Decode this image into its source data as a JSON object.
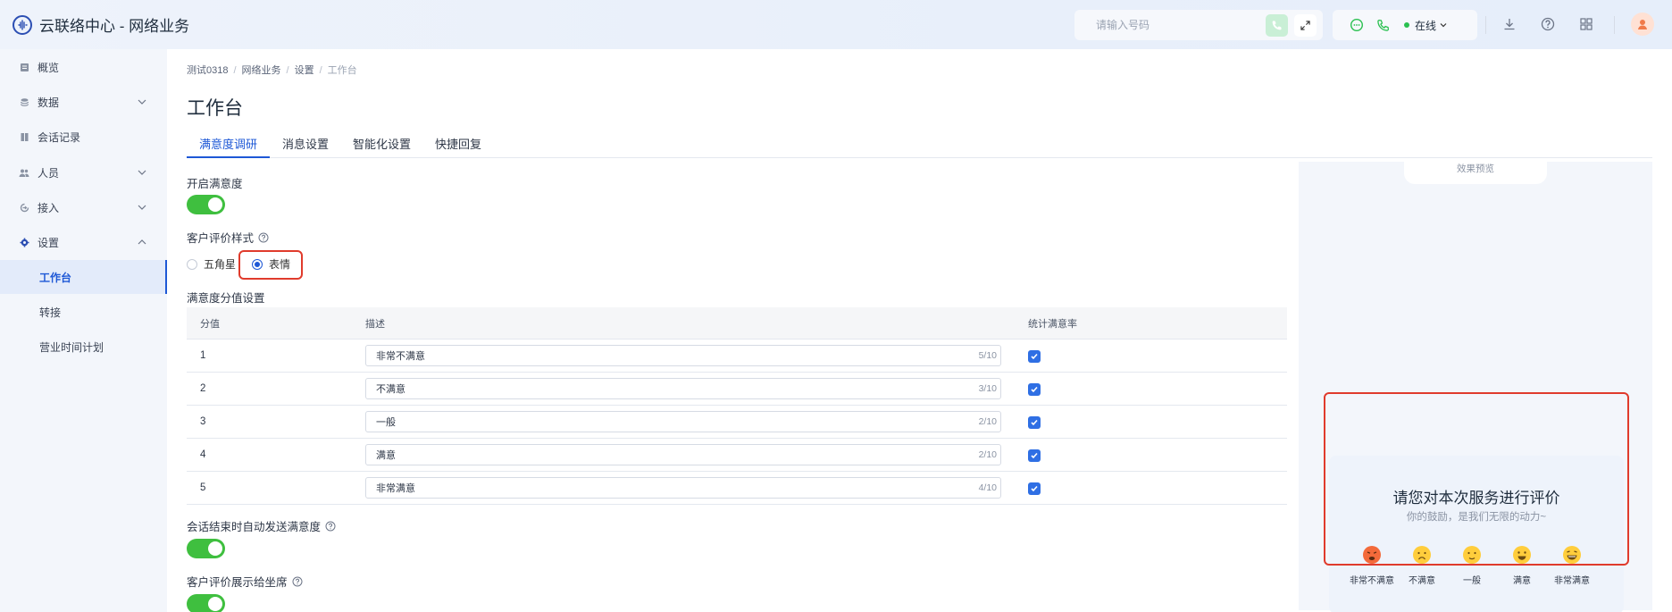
{
  "app": {
    "title": "云联络中心 - 网络业务"
  },
  "topbar": {
    "phone_placeholder": "请输入号码",
    "status_label": "在线",
    "icons": [
      "message-icon",
      "phone-icon",
      "download-icon",
      "help-icon",
      "grid-icon",
      "avatar"
    ]
  },
  "sidebar": {
    "items": [
      {
        "label": "概览",
        "icon": "overview-icon"
      },
      {
        "label": "数据",
        "icon": "data-icon",
        "expandable": true
      },
      {
        "label": "会话记录",
        "icon": "records-icon"
      },
      {
        "label": "人员",
        "icon": "people-icon",
        "expandable": true
      },
      {
        "label": "接入",
        "icon": "access-icon",
        "expandable": true
      },
      {
        "label": "设置",
        "icon": "settings-icon",
        "expanded": true
      }
    ],
    "sub_items": [
      {
        "label": "工作台",
        "active": true
      },
      {
        "label": "转接"
      },
      {
        "label": "营业时间计划"
      }
    ]
  },
  "breadcrumb": [
    "测试0318",
    "网络业务",
    "设置",
    "工作台"
  ],
  "page_title": "工作台",
  "tabs": [
    "满意度调研",
    "消息设置",
    "智能化设置",
    "快捷回复"
  ],
  "form": {
    "enable_label": "开启满意度",
    "style_label": "客户评价样式",
    "style_options": [
      "五角星",
      "表情"
    ],
    "style_selected": "表情",
    "score_section_label": "满意度分值设置",
    "auto_send_label": "会话结束时自动发送满意度",
    "show_agent_label": "客户评价展示给坐席"
  },
  "table": {
    "headers": [
      "分值",
      "描述",
      "统计满意率"
    ],
    "rows": [
      {
        "score": "1",
        "desc": "非常不满意",
        "count": "5/10",
        "checked": true
      },
      {
        "score": "2",
        "desc": "不满意",
        "count": "3/10",
        "checked": true
      },
      {
        "score": "3",
        "desc": "一般",
        "count": "2/10",
        "checked": true
      },
      {
        "score": "4",
        "desc": "满意",
        "count": "2/10",
        "checked": true
      },
      {
        "score": "5",
        "desc": "非常满意",
        "count": "4/10",
        "checked": true
      }
    ]
  },
  "preview": {
    "tab_label": "效果预览",
    "title": "请您对本次服务进行评价",
    "subtitle": "你的鼓励，是我们无限的动力~",
    "emojis": [
      "非常不满意",
      "不满意",
      "一般",
      "满意",
      "非常满意"
    ]
  },
  "colors": {
    "accent": "#1e58d6",
    "toggle_on": "#3fbf3f",
    "highlight": "#e03b2c",
    "online": "#2ac050"
  }
}
